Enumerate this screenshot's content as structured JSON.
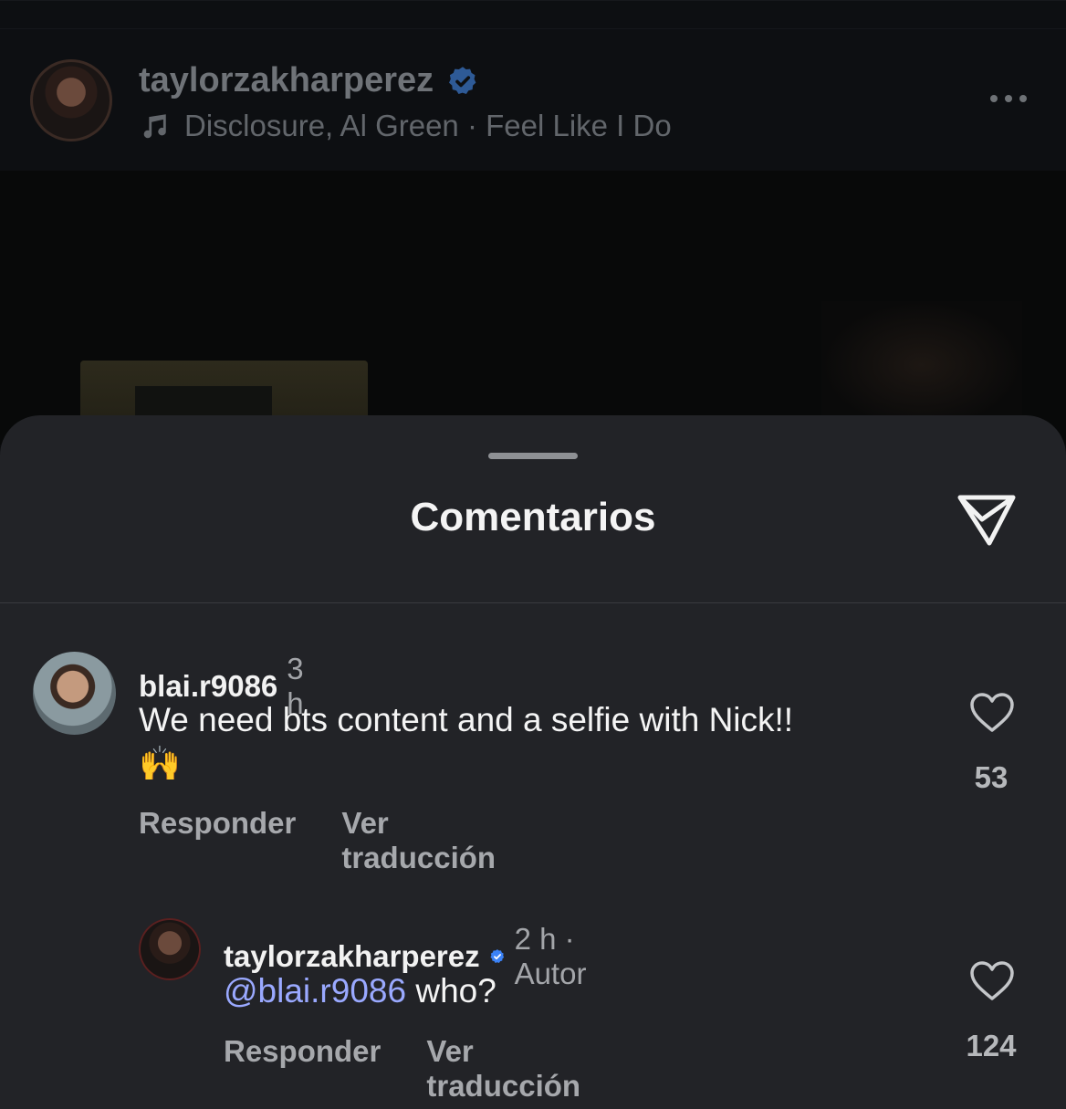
{
  "post": {
    "username": "taylorzakharperez",
    "music": "Disclosure, Al Green · Feel Like I Do"
  },
  "sheet": {
    "title": "Comentarios"
  },
  "comments": [
    {
      "username": "blai.r9086",
      "time": "3 h",
      "text": "We need bts content and a selfie with Nick!!",
      "emoji": "🙌",
      "reply_label": "Responder",
      "translate_label": "Ver traducción",
      "likes": "53"
    },
    {
      "username": "taylorzakharperez",
      "time": "2 h · Autor",
      "mention": "@blai.r9086",
      "text": "who?",
      "reply_label": "Responder",
      "translate_label": "Ver traducción",
      "likes": "124"
    }
  ],
  "colors": {
    "sheet_bg": "#222327",
    "verified": "#3b82f6",
    "mention": "#9aa9ff"
  }
}
